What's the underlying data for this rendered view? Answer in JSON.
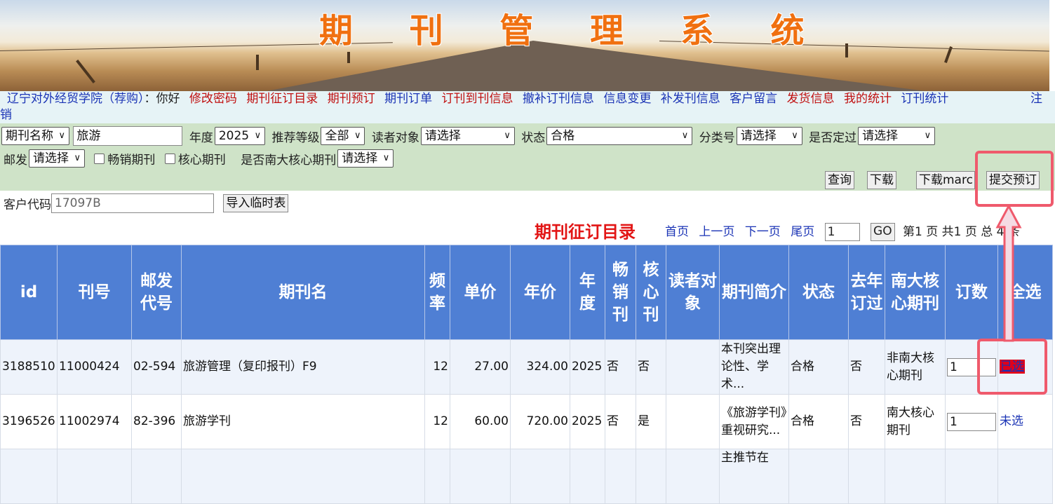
{
  "banner": {
    "title": "期 刊 管 理 系 统"
  },
  "nav": {
    "institution": "辽宁对外经贸学院（荐购）",
    "greeting": "：你好",
    "links": [
      {
        "label": "修改密码",
        "color": "red"
      },
      {
        "label": "期刊征订目录",
        "color": "red"
      },
      {
        "label": "期刊预订",
        "color": "red"
      },
      {
        "label": "期刊订单",
        "color": "blue"
      },
      {
        "label": "订刊到刊信息",
        "color": "red"
      },
      {
        "label": "撤补订刊信息",
        "color": "blue"
      },
      {
        "label": "信息变更",
        "color": "blue"
      },
      {
        "label": "补发刊信息",
        "color": "blue"
      },
      {
        "label": "客户留言",
        "color": "blue"
      },
      {
        "label": "发货信息",
        "color": "red"
      },
      {
        "label": "我的统计",
        "color": "red"
      },
      {
        "label": "订刊统计",
        "color": "blue"
      }
    ],
    "logout_part1": "注",
    "logout_part2": "销"
  },
  "filters": {
    "field_select": "期刊名称",
    "keyword": "旅游",
    "year_label": "年度",
    "year_value": "2025",
    "level_label": "推荐等级",
    "level_value": "全部",
    "reader_label": "读者对象",
    "reader_value": "请选择",
    "status_label": "状态",
    "status_value": "合格",
    "class_label": "分类号",
    "class_value": "请选择",
    "fixed_label": "是否定过",
    "fixed_value": "请选择",
    "post_label": "邮发",
    "post_value": "请选择",
    "bestseller_label": "畅销期刊",
    "core_label": "核心期刊",
    "nanda_label": "是否南大核心期刊",
    "nanda_value": "请选择",
    "buttons": {
      "query": "查询",
      "download": "下载",
      "download_marc": "下载marc",
      "submit": "提交预订"
    }
  },
  "client": {
    "label": "客户代码",
    "value": "17097B",
    "import_button": "导入临时表"
  },
  "list": {
    "title": "期刊征订目录"
  },
  "pager": {
    "first": "首页",
    "prev": "上一页",
    "next": "下一页",
    "last": "尾页",
    "page_input": "1",
    "go": "GO",
    "info": "第1 页  共1 页 总 4 条"
  },
  "table": {
    "headers": {
      "id": "id",
      "kanhao": "刊号",
      "youfa": "邮发代号",
      "name": "期刊名",
      "freq": "频率",
      "price": "单价",
      "annual": "年价",
      "year": "年度",
      "bestseller": "畅销刊",
      "core": "核心刊",
      "reader": "读者对象",
      "intro": "期刊简介",
      "status": "状态",
      "last_year": "去年订过",
      "nanda": "南大核心期刊",
      "qty": "订数",
      "select_all": "全选"
    },
    "rows": [
      {
        "id": "3188510",
        "kanhao": "11000424",
        "youfa": "02-594",
        "name": "旅游管理（复印报刊）F9",
        "freq": "12",
        "price": "27.00",
        "annual": "324.00",
        "year": "2025",
        "bestseller": "否",
        "core": "否",
        "reader": "",
        "intro": "本刊突出理论性、学术...",
        "status": "合格",
        "last_year": "否",
        "nanda": "非南大核心期刊",
        "qty": "1",
        "select": "已选"
      },
      {
        "id": "3196526",
        "kanhao": "11002974",
        "youfa": "82-396",
        "name": "旅游学刊",
        "freq": "12",
        "price": "60.00",
        "annual": "720.00",
        "year": "2025",
        "bestseller": "否",
        "core": "是",
        "reader": "",
        "intro": "《旅游学刊》重视研究...",
        "status": "合格",
        "last_year": "否",
        "nanda": "南大核心期刊",
        "qty": "1",
        "select": "未选"
      },
      {
        "intro": "主推节在"
      }
    ]
  },
  "colors": {
    "header_bg": "#4f7fd4",
    "filter_bg": "#cfe3c8",
    "nav_bg": "#e6f3f6",
    "title_red": "#e21515",
    "highlight": "#ef5a6c"
  }
}
